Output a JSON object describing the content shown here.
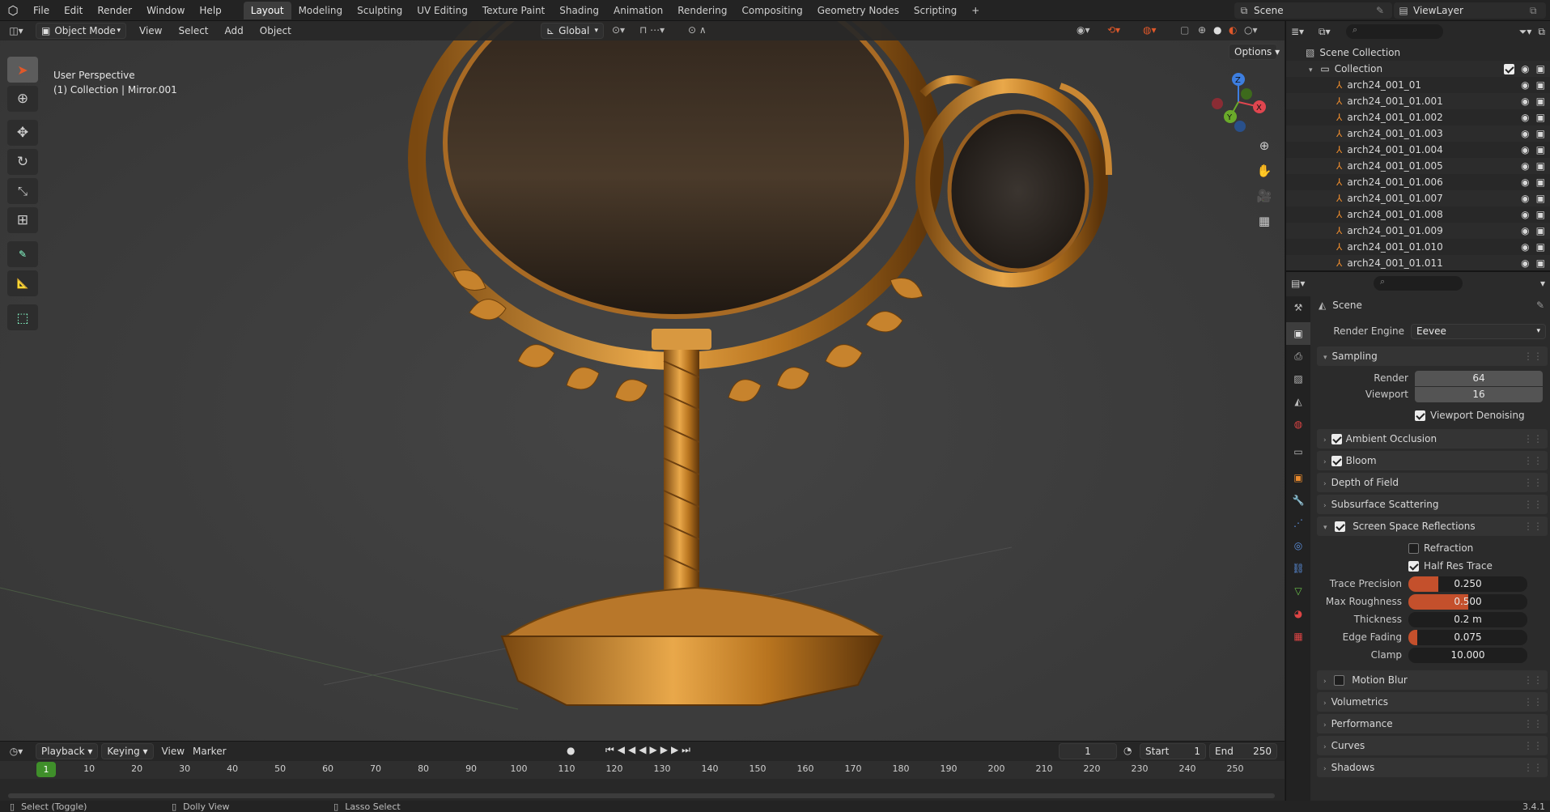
{
  "topbar": {
    "menus": [
      "File",
      "Edit",
      "Render",
      "Window",
      "Help"
    ],
    "workspaces": [
      "Layout",
      "Modeling",
      "Sculpting",
      "UV Editing",
      "Texture Paint",
      "Shading",
      "Animation",
      "Rendering",
      "Compositing",
      "Geometry Nodes",
      "Scripting"
    ],
    "active_workspace": "Layout",
    "add_tab_label": "+",
    "scene_name": "Scene",
    "view_layer": "ViewLayer"
  },
  "viewport": {
    "mode": "Object Mode",
    "menus": [
      "View",
      "Select",
      "Add",
      "Object"
    ],
    "transform_orientation": "Global",
    "options_label": "Options",
    "overlay_title": "User Perspective",
    "overlay_subtitle": "(1) Collection | Mirror.001",
    "gizmo": {
      "x": "X",
      "y": "Y",
      "z": "Z"
    }
  },
  "timeline": {
    "menus": [
      "Playback",
      "Keying",
      "View",
      "Marker"
    ],
    "current_frame": "1",
    "start_label": "Start",
    "start": "1",
    "end_label": "End",
    "end": "250",
    "ticks": [
      "1",
      "10",
      "20",
      "30",
      "40",
      "50",
      "60",
      "70",
      "80",
      "90",
      "100",
      "110",
      "120",
      "130",
      "140",
      "150",
      "160",
      "170",
      "180",
      "190",
      "200",
      "210",
      "220",
      "230",
      "240",
      "250"
    ]
  },
  "statusbar": {
    "left": "Select (Toggle)",
    "middle": "Dolly View",
    "right": "Lasso Select",
    "version": "3.4.1"
  },
  "outliner": {
    "root": "Scene Collection",
    "collection": "Collection",
    "items": [
      "arch24_001_01",
      "arch24_001_01.001",
      "arch24_001_01.002",
      "arch24_001_01.003",
      "arch24_001_01.004",
      "arch24_001_01.005",
      "arch24_001_01.006",
      "arch24_001_01.007",
      "arch24_001_01.008",
      "arch24_001_01.009",
      "arch24_001_01.010",
      "arch24_001_01.011"
    ]
  },
  "properties": {
    "context": "Scene",
    "render_engine_label": "Render Engine",
    "render_engine": "Eevee",
    "sampling": {
      "title": "Sampling",
      "render_label": "Render",
      "render": "64",
      "viewport_label": "Viewport",
      "viewport": "16",
      "denoise_label": "Viewport Denoising"
    },
    "panels_a": [
      {
        "label": "Ambient Occlusion",
        "checkbox": true
      },
      {
        "label": "Bloom",
        "checkbox": true
      },
      {
        "label": "Depth of Field",
        "checkbox": false
      },
      {
        "label": "Subsurface Scattering",
        "checkbox": false
      }
    ],
    "ssr": {
      "title": "Screen Space Reflections",
      "refraction_label": "Refraction",
      "half_res_label": "Half Res Trace",
      "trace_precision_label": "Trace Precision",
      "trace_precision": "0.250",
      "trace_precision_fill": 0.25,
      "max_roughness_label": "Max Roughness",
      "max_roughness": "0.500",
      "max_roughness_fill": 0.5,
      "thickness_label": "Thickness",
      "thickness": "0.2 m",
      "edge_fading_label": "Edge Fading",
      "edge_fading": "0.075",
      "edge_fading_fill": 0.075,
      "clamp_label": "Clamp",
      "clamp": "10.000"
    },
    "motion_blur": "Motion Blur",
    "panels_b": [
      "Volumetrics",
      "Performance",
      "Curves",
      "Shadows"
    ]
  },
  "colors": {
    "accent": "#e0582a",
    "slider_fill": "#c4502c",
    "gold": "#c9872a"
  }
}
